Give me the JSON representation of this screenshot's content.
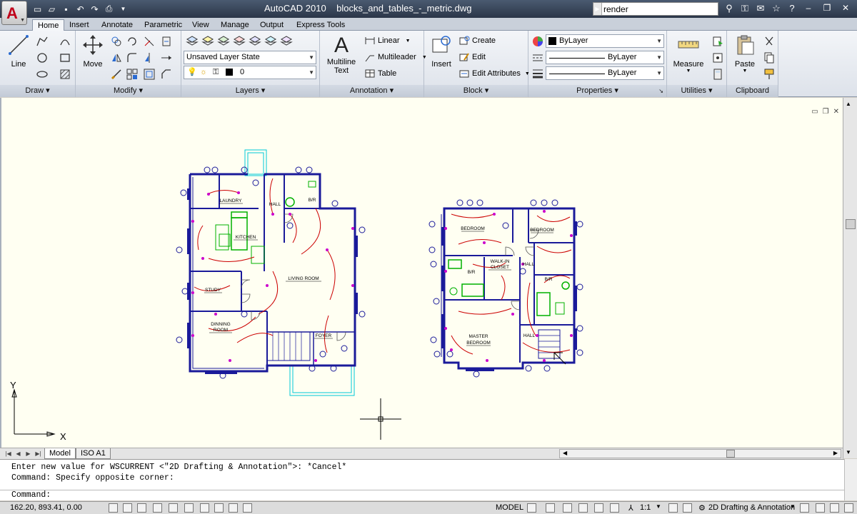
{
  "title_bar": {
    "title": "AutoCAD 2010    blocks_and_tables_-_metric.dwg",
    "search_value": "render",
    "app_logo": "A"
  },
  "ribbon_tabs": [
    "Home",
    "Insert",
    "Annotate",
    "Parametric",
    "View",
    "Manage",
    "Output",
    "Express Tools"
  ],
  "panels": {
    "draw": {
      "title": "Draw",
      "line_label": "Line"
    },
    "modify": {
      "title": "Modify",
      "move_label": "Move"
    },
    "layers": {
      "title": "Layers",
      "layer_state": "Unsaved Layer State",
      "current_layer": "0"
    },
    "annotation": {
      "title": "Annotation",
      "mtext_label_1": "Multiline",
      "mtext_label_2": "Text",
      "linear": "Linear",
      "multileader": "Multileader",
      "table": "Table"
    },
    "block": {
      "title": "Block",
      "insert_label": "Insert",
      "create": "Create",
      "edit": "Edit",
      "edit_attributes": "Edit Attributes"
    },
    "properties": {
      "title": "Properties",
      "color": "ByLayer",
      "linetype": "ByLayer",
      "lineweight": "ByLayer"
    },
    "utilities": {
      "title": "Utilities",
      "measure": "Measure"
    },
    "clipboard": {
      "title": "Clipboard",
      "paste": "Paste"
    }
  },
  "drawing": {
    "rooms_left": [
      "LAUNDRY",
      "HALL",
      "B/R",
      "KITCHEN",
      "LIVING ROOM",
      "STUDY",
      "DINNING",
      "ROOM",
      "FOYER"
    ],
    "rooms_right": [
      "BEDROOM",
      "BEDROOM",
      "B/R",
      "WALK-IN",
      "CLOSET",
      "HALL",
      "B/R",
      "MASTER",
      "BEDROOM",
      "HALL"
    ],
    "ucs_x": "X",
    "ucs_y": "Y"
  },
  "layout_tabs": [
    "Model",
    "ISO A1"
  ],
  "command": {
    "line1": "Enter new value for WSCURRENT <\"2D Drafting & Annotation\">: *Cancel*",
    "line2": "Command: Specify opposite corner:",
    "prompt": "Command:"
  },
  "status": {
    "coords": "162.20, 893.41, 0.00",
    "space": "MODEL",
    "scale": "1:1",
    "workspace": "2D Drafting & Annotation"
  },
  "colors": {
    "canvas": "#fffff2",
    "wall": "#1a1a9a",
    "electrical": "#cc0000",
    "fixture": "#00b000",
    "outlet": "#cc00cc",
    "cyan": "#00c8d8"
  }
}
